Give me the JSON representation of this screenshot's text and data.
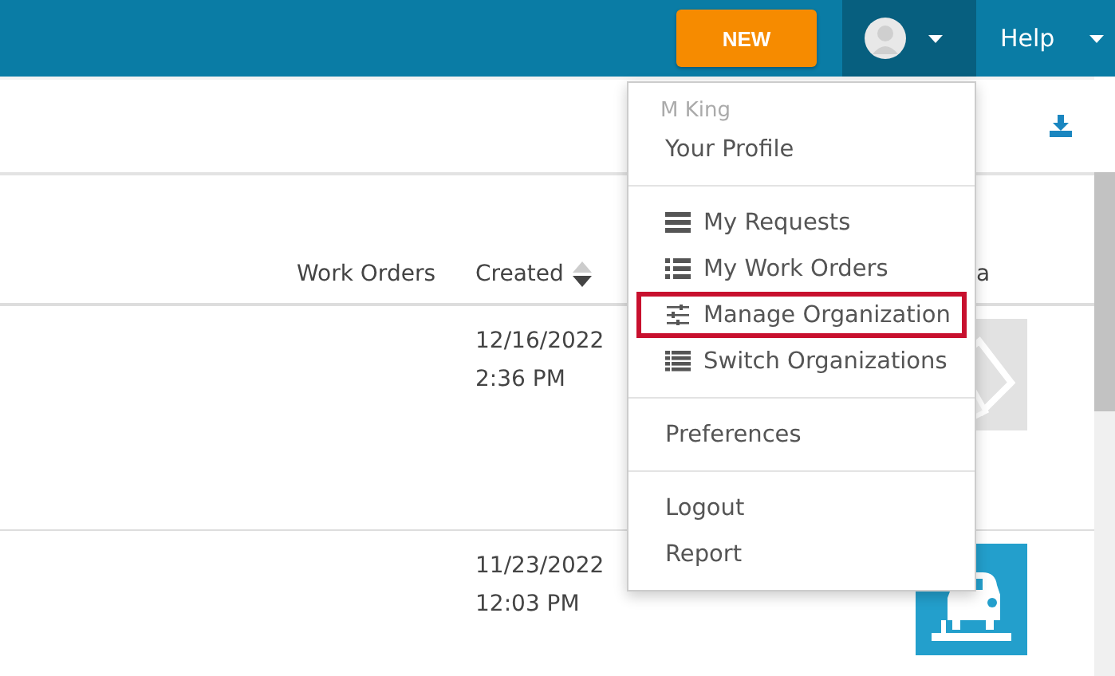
{
  "top_bar": {
    "new_button": "NEW",
    "help_menu": "Help"
  },
  "table": {
    "columns": [
      {
        "label": "Work Orders",
        "sortable": false
      },
      {
        "label": "Created",
        "sortable": true
      },
      {
        "label": "a",
        "sortable": false
      }
    ],
    "rows": [
      {
        "created": "12/16/2022",
        "time": "2:36 PM",
        "kind": "generic"
      },
      {
        "created": "11/23/2022",
        "time": "12:03 PM",
        "kind": "vehicle"
      }
    ]
  },
  "user_menu": {
    "user_name": "M King",
    "sections": [
      [
        {
          "label": "Your Profile",
          "kind": "plain",
          "highlighted": false
        }
      ],
      [
        {
          "label": "My Requests",
          "kind": "stack",
          "highlighted": false
        },
        {
          "label": "My Work Orders",
          "kind": "list",
          "highlighted": false
        },
        {
          "label": "Manage Organization",
          "kind": "sliders",
          "highlighted": true
        },
        {
          "label": "Switch Organizations",
          "kind": "rows",
          "highlighted": false
        }
      ],
      [
        {
          "label": "Preferences",
          "kind": "plain",
          "highlighted": false
        }
      ],
      [
        {
          "label": "Logout",
          "kind": "plain",
          "highlighted": false
        },
        {
          "label": "Report",
          "kind": "plain",
          "highlighted": false
        }
      ]
    ]
  }
}
